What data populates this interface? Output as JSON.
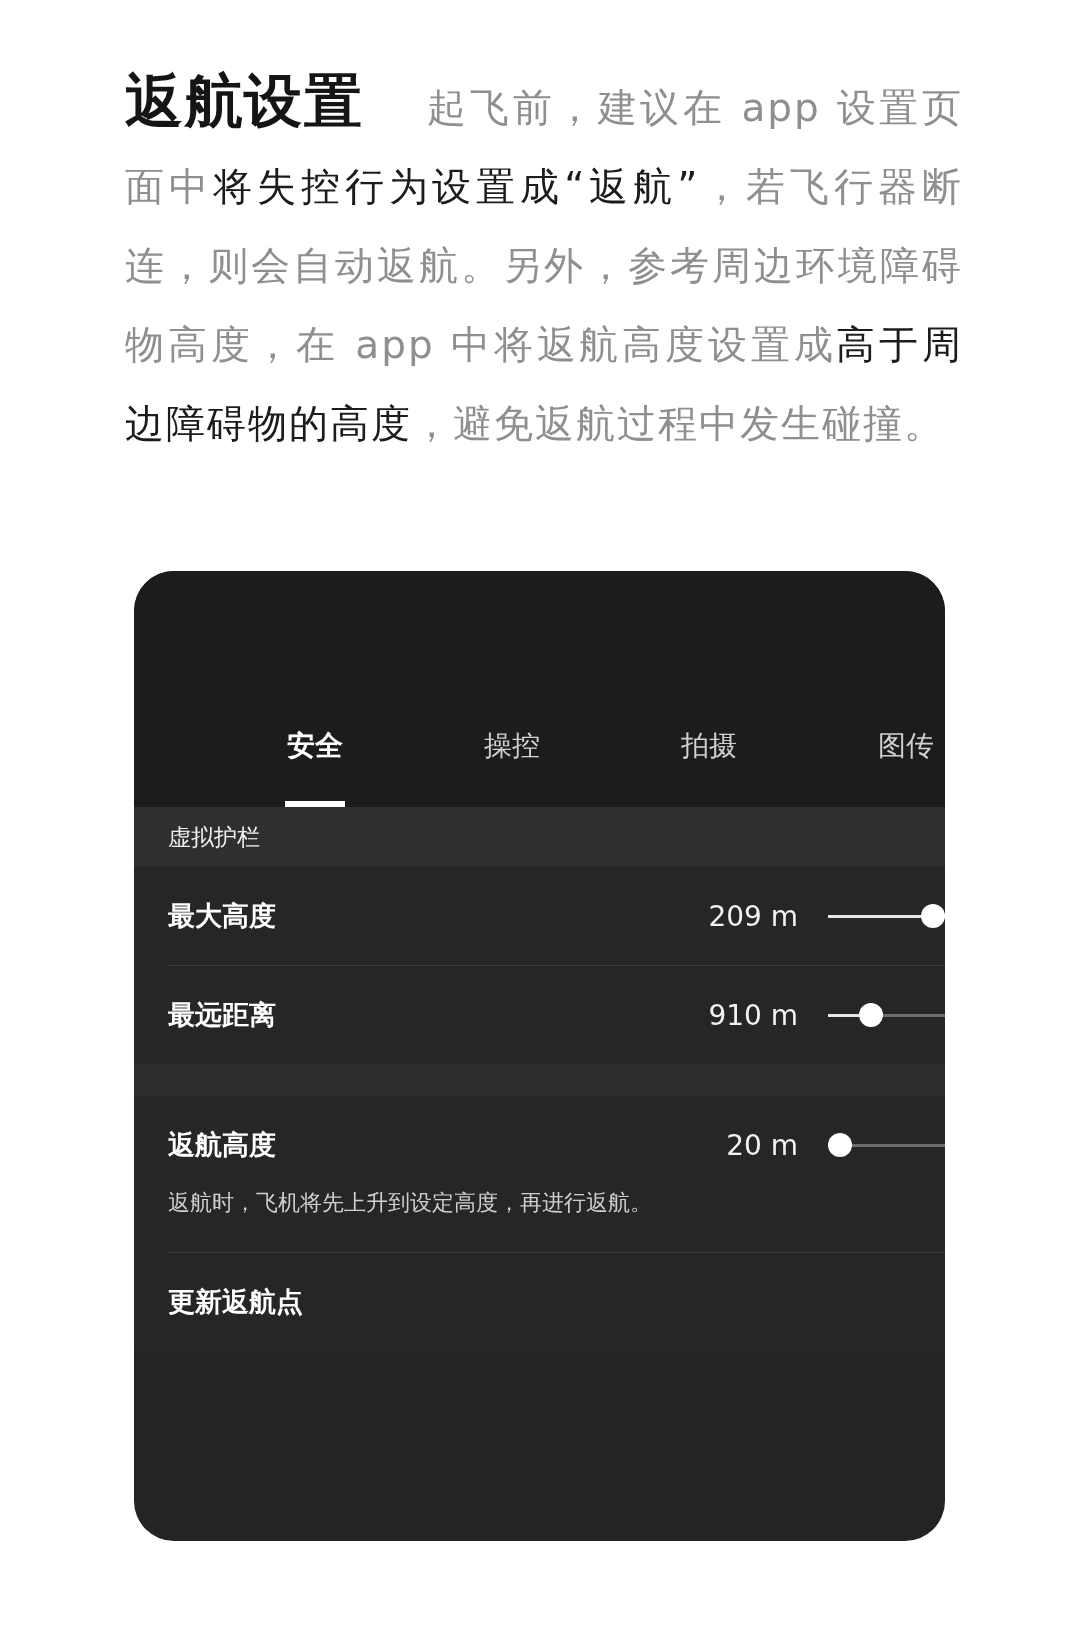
{
  "article": {
    "title": "返航设置",
    "paragraph": "起飞前，建议在 app 设置页面中**将失控行为设置成“返航”**，若飞行器断连，则会自动返航。另外，参考周边环境障碍物高度，在 app 中将返航高度设置成**高于周边障碍物的高度**，避免返航过程中发生碰撞。"
  },
  "screen": {
    "tabs": [
      {
        "label": "安全",
        "selected": true
      },
      {
        "label": "操控",
        "selected": false
      },
      {
        "label": "拍摄",
        "selected": false
      },
      {
        "label": "图传",
        "selected": false
      }
    ],
    "sections": [
      {
        "header": "虚拟护栏",
        "rows": [
          {
            "kind": "slider",
            "label": "最大高度",
            "reading": "209 m",
            "level": 1
          },
          {
            "kind": "slider",
            "label": "最远距离",
            "reading": "910 m",
            "level": 0.33
          }
        ]
      },
      {
        "rows": [
          {
            "kind": "slider",
            "label": "返航高度",
            "reading": "20 m",
            "level": 0,
            "description": "返航时，飞机将先上升到设定高度，再进行返航。"
          },
          {
            "kind": "action",
            "label": "更新返航点"
          }
        ]
      }
    ]
  }
}
